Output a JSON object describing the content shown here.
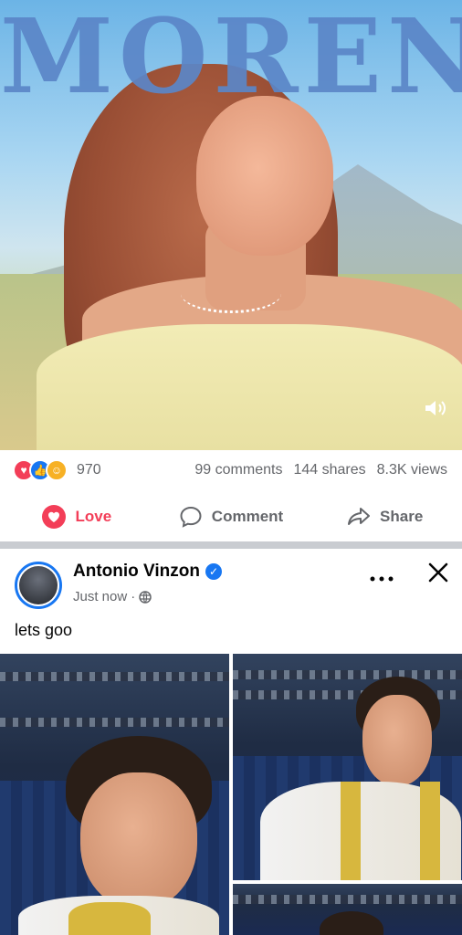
{
  "video_post": {
    "title_overlay": "MORENA",
    "volume_icon": "volume-icon",
    "reaction_icons": [
      "love-reaction-icon",
      "like-reaction-icon",
      "care-reaction-icon"
    ],
    "reaction_count": "970",
    "comments": "99 comments",
    "shares": "144 shares",
    "views": "8.3K views"
  },
  "actions": {
    "love_label": "Love",
    "comment_label": "Comment",
    "share_label": "Share"
  },
  "post": {
    "author": "Antonio Vinzon",
    "verified_icon": "verified-badge-icon",
    "timestamp": "Just now",
    "separator": "·",
    "audience_icon": "globe-icon",
    "more_icon": "more-options-icon",
    "close_icon": "close-icon",
    "caption": "lets goo"
  },
  "colors": {
    "brand_blue": "#1877f2",
    "love_red": "#f33e58",
    "text_secondary": "#65676b"
  }
}
